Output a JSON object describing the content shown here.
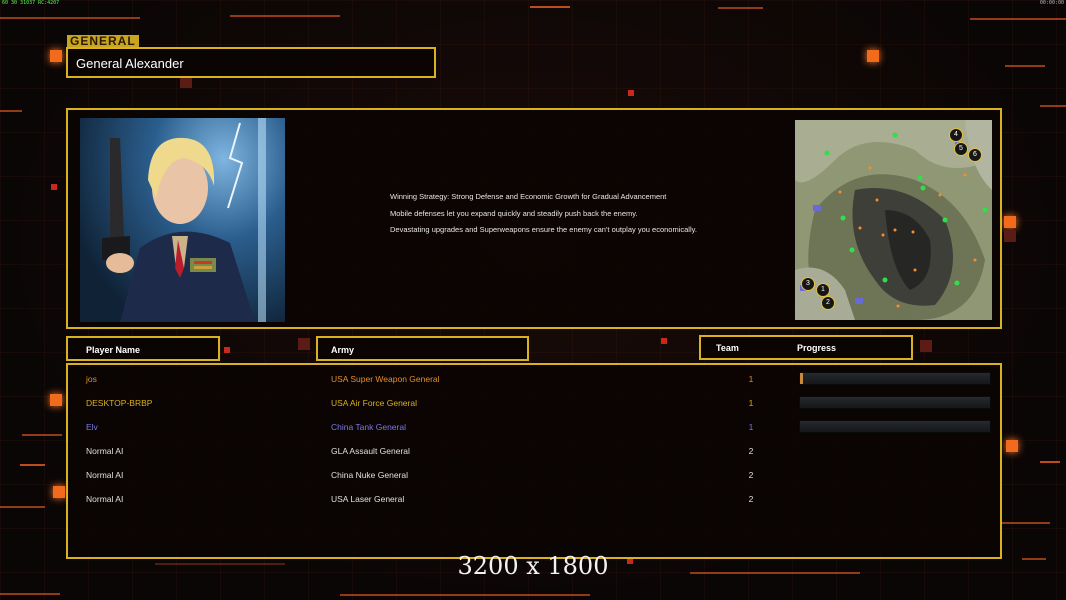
{
  "hud": {
    "top_left_text": "60 30 31037 RC:4207",
    "top_right_text": "00:00:00"
  },
  "general": {
    "tag": "GENERAL",
    "name": "General Alexander",
    "strategy": [
      "Winning Strategy: Strong Defense and Economic Growth for Gradual Advancement",
      "Mobile defenses let you expand quickly and steadily push back the enemy.",
      "Devastating upgrades and Superweapons ensure the enemy can't outplay you economically."
    ]
  },
  "minimap": {
    "start_positions": [
      "4",
      "5",
      "6",
      "3",
      "1",
      "2"
    ]
  },
  "table": {
    "headers": {
      "player": "Player Name",
      "army": "Army",
      "team": "Team",
      "progress": "Progress"
    },
    "rows": [
      {
        "name": "jos",
        "army": "USA Super Weapon General",
        "team": "1",
        "color": "#e0902a",
        "progress": 0.01
      },
      {
        "name": "DESKTOP-BRBP",
        "army": "USA Air Force General",
        "team": "1",
        "color": "#d8b21a",
        "progress": 0
      },
      {
        "name": "Elv",
        "army": "China Tank General",
        "team": "1",
        "color": "#7a7ae6",
        "progress": 0
      },
      {
        "name": "Normal AI",
        "army": "GLA Assault General",
        "team": "2",
        "color": "#e0e0e0",
        "progress": null
      },
      {
        "name": "Normal AI",
        "army": "China Nuke General",
        "team": "2",
        "color": "#e0e0e0",
        "progress": null
      },
      {
        "name": "Normal AI",
        "army": "USA Laser General",
        "team": "2",
        "color": "#e0e0e0",
        "progress": null
      }
    ]
  },
  "resolution_label": "3200 x 1800"
}
